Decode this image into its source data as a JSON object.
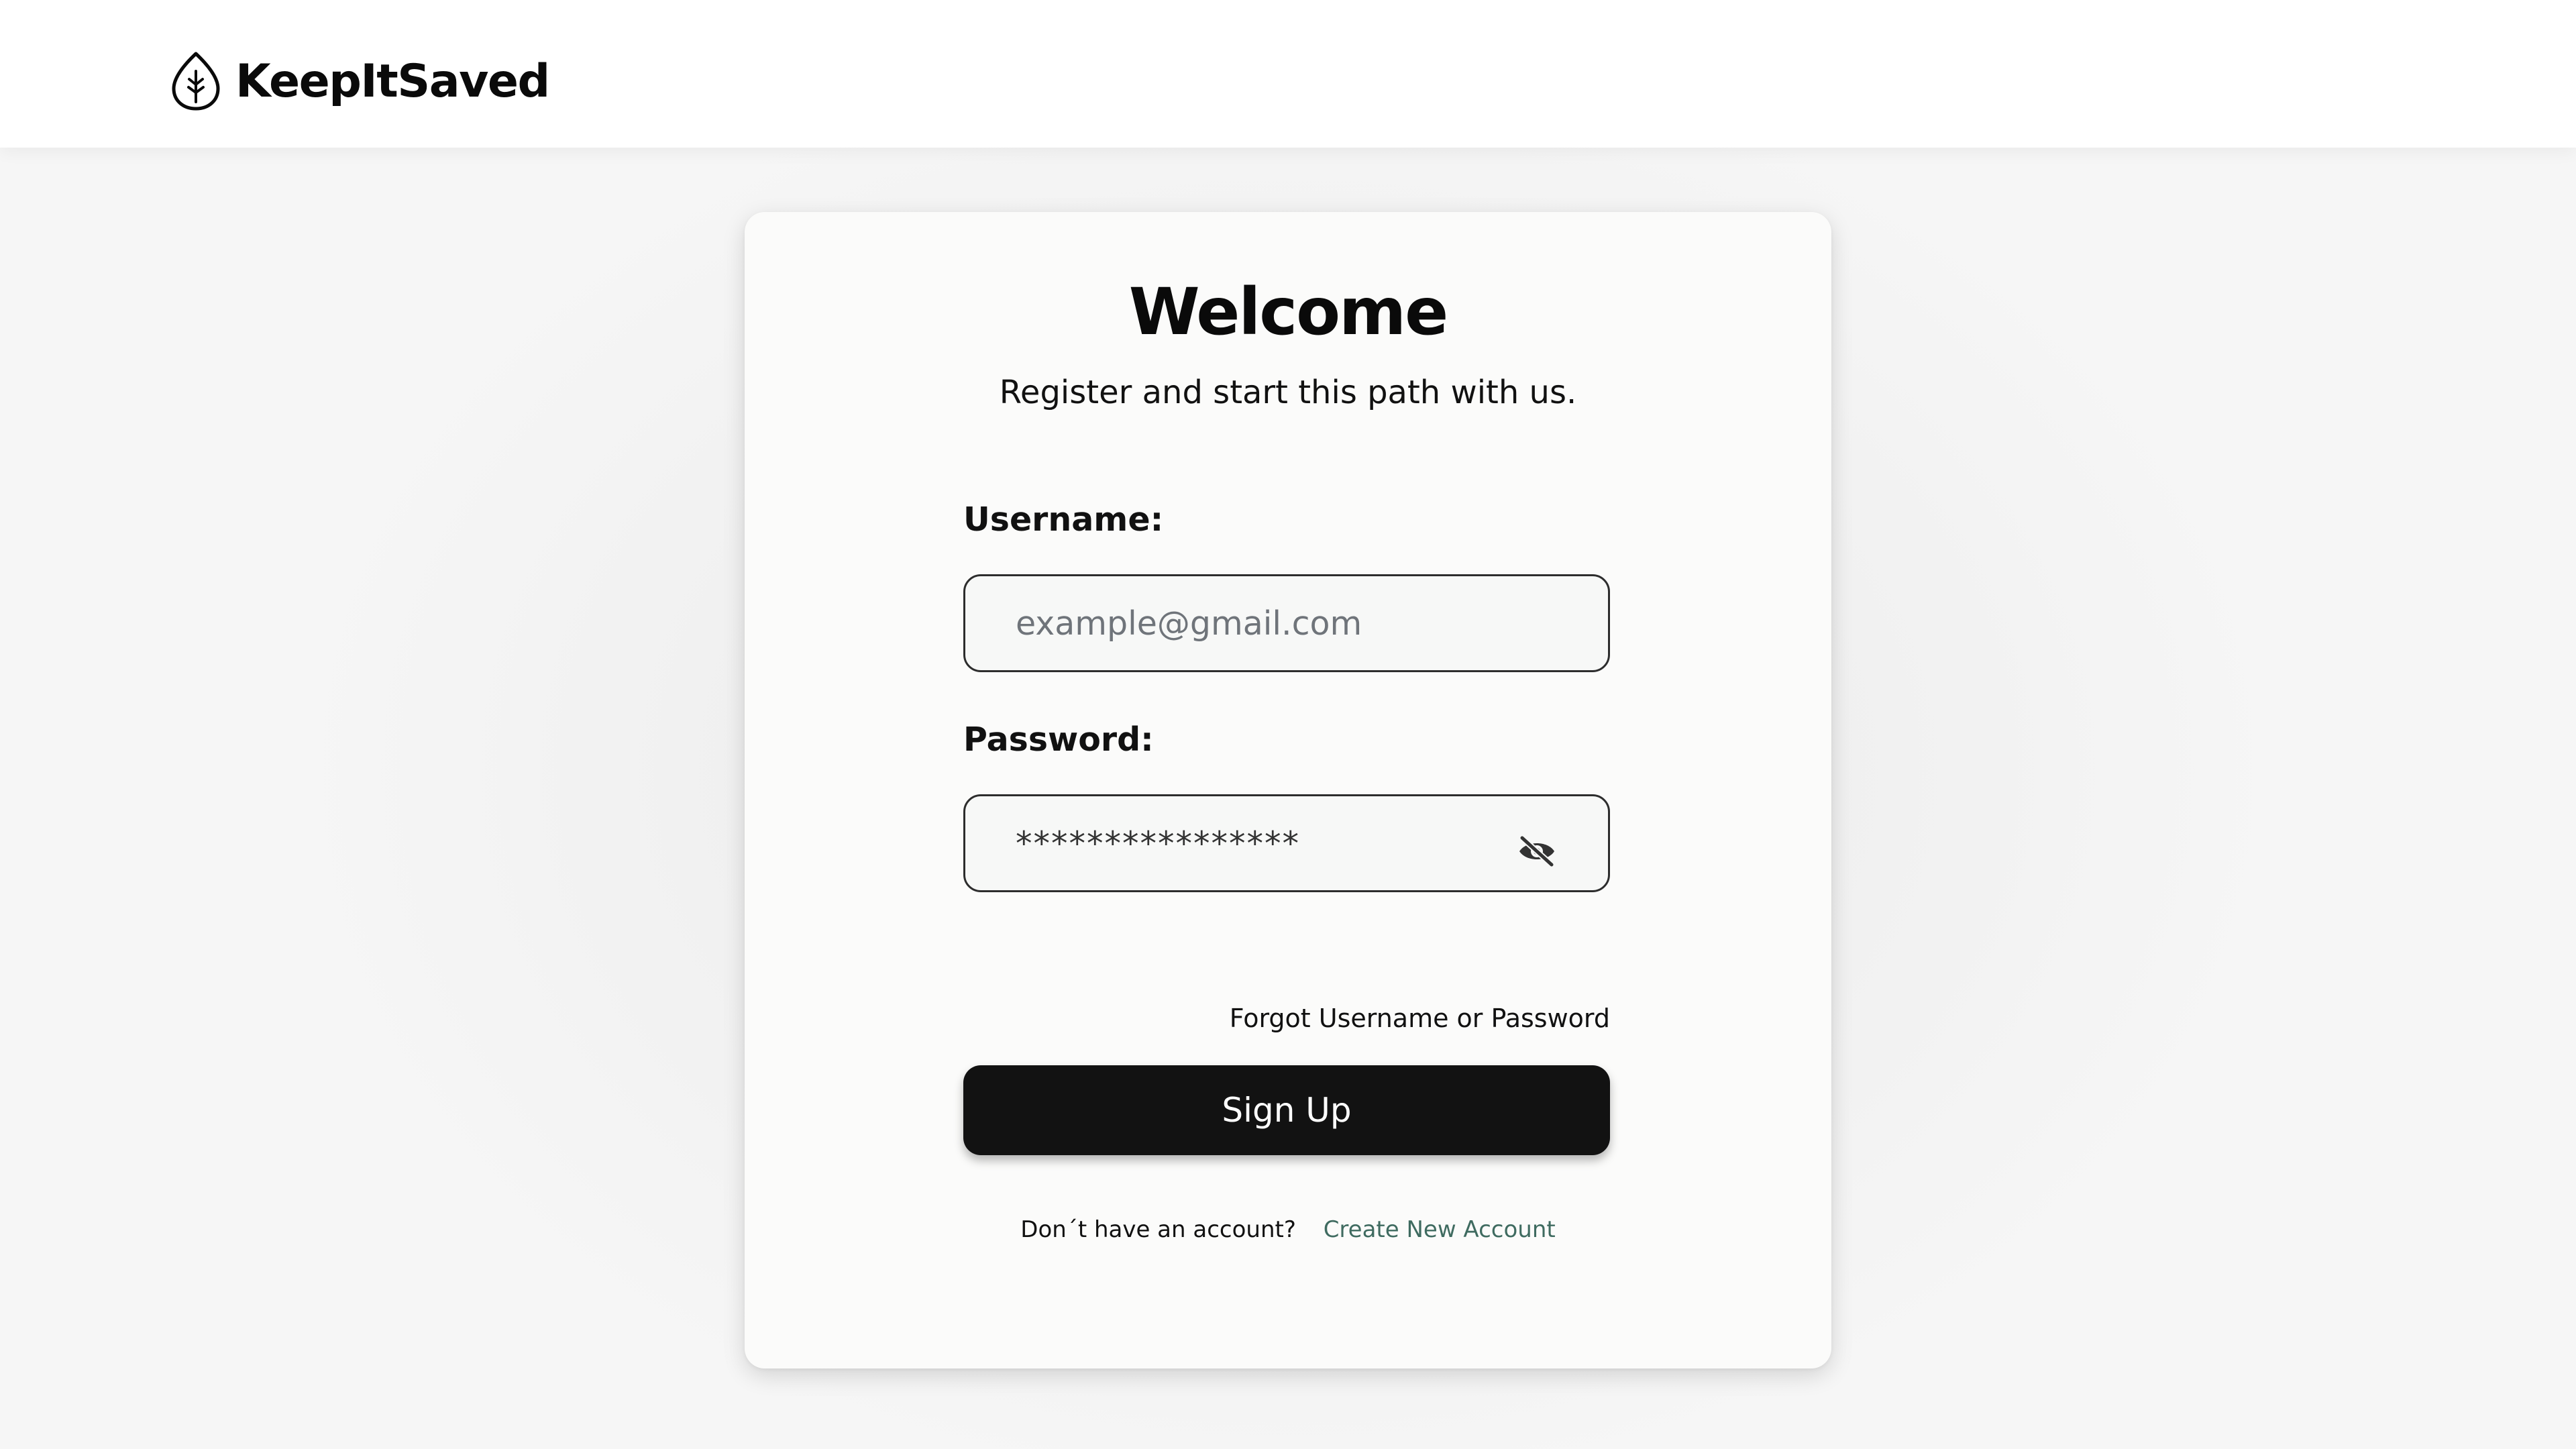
{
  "header": {
    "brand_name": "KeepItSaved",
    "logo_icon": "leaf-tree-icon"
  },
  "card": {
    "title": "Welcome",
    "subtitle": "Register and start this path with us."
  },
  "form": {
    "username": {
      "label": "Username:",
      "placeholder": "example@gmail.com",
      "value": ""
    },
    "password": {
      "label": "Password:",
      "value": "****************",
      "visibility_icon": "eye-slash-icon"
    },
    "forgot_link": "Forgot Username or Password",
    "submit_label": "Sign Up"
  },
  "footer": {
    "prompt": "Don´t have an account?",
    "link": "Create New Account"
  },
  "colors": {
    "button_bg": "#121212",
    "link": "#3f6b60",
    "card_bg": "#fbfbfa"
  }
}
